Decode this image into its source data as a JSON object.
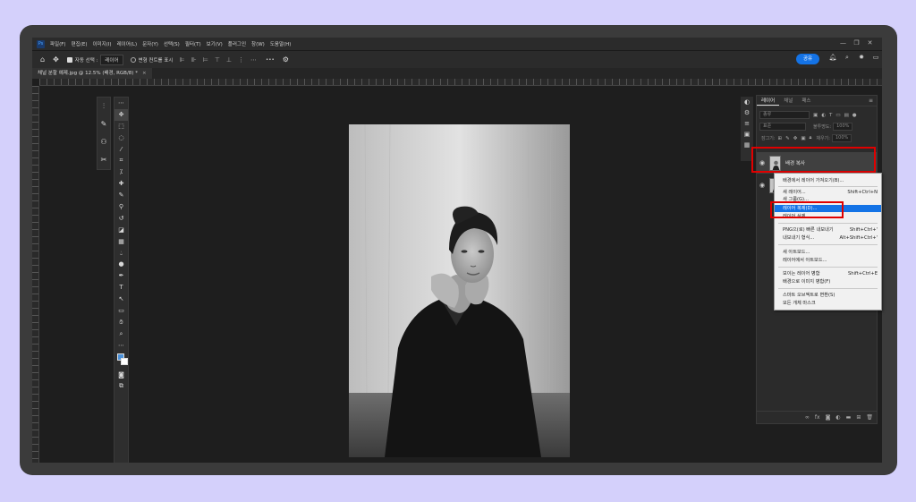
{
  "menubar": {
    "logo": "Ps",
    "items": [
      "파일(F)",
      "편집(E)",
      "이미지(I)",
      "레이어(L)",
      "문자(Y)",
      "선택(S)",
      "필터(T)",
      "보기(V)",
      "플러그인",
      "창(W)",
      "도움말(H)"
    ],
    "window_controls": [
      "—",
      "❐",
      "✕"
    ]
  },
  "optionsbar": {
    "auto_select_label": "자동 선택 :",
    "auto_select_value": "레이어",
    "transform_label": "변형 컨트롤 표시",
    "more": "•••",
    "share_label": "공유"
  },
  "document": {
    "tab_title": "채널 분할 예제.jpg @ 12.5% (배경, RGB/8) *",
    "close": "×"
  },
  "layers_panel": {
    "tabs": [
      "레이어",
      "채널",
      "패스"
    ],
    "kind_filter": "종류",
    "blend_mode": "표준",
    "opacity_label": "불투명도:",
    "opacity_value": "100%",
    "lock_label": "잠그기:",
    "fill_label": "채우기:",
    "fill_value": "100%",
    "layers": [
      {
        "name": "배경 복사",
        "selected": true
      },
      {
        "name": "배경",
        "selected": false
      }
    ]
  },
  "context_menu": {
    "items": [
      {
        "label": "배경에서 레이어 가져오기(B)...",
        "shortcut": "",
        "highlighted": false
      },
      {
        "label": "새 레이어...",
        "shortcut": "Shift+Ctrl+N",
        "highlighted": false
      },
      {
        "label": "새 그룹(G)...",
        "shortcut": "",
        "highlighted": false
      },
      {
        "label": "레이어 복제(D)...",
        "shortcut": "",
        "highlighted": true
      },
      {
        "label": "레이어 삭제",
        "shortcut": "",
        "highlighted": false
      },
      {
        "label": "PNG으(로) 빠른 내보내기",
        "shortcut": "Shift+Ctrl+'",
        "highlighted": false
      },
      {
        "label": "내보내기 형식...",
        "shortcut": "Alt+Shift+Ctrl+'",
        "highlighted": false
      },
      {
        "label": "새 아트보드...",
        "shortcut": "",
        "highlighted": false
      },
      {
        "label": "레이어에서 아트보드...",
        "shortcut": "",
        "highlighted": false
      },
      {
        "label": "보이는 레이어 병합",
        "shortcut": "Shift+Ctrl+E",
        "highlighted": false
      },
      {
        "label": "배경으로 이미지 병합(F)",
        "shortcut": "",
        "highlighted": false
      },
      {
        "label": "스마트 오브젝트로 변환(S)",
        "shortcut": "",
        "highlighted": false
      },
      {
        "label": "모든 개체 마스크",
        "shortcut": "",
        "highlighted": false
      }
    ]
  },
  "colors": {
    "accent": "#1473e6",
    "highlight_box": "#e00000",
    "background": "#d4d0fb"
  }
}
